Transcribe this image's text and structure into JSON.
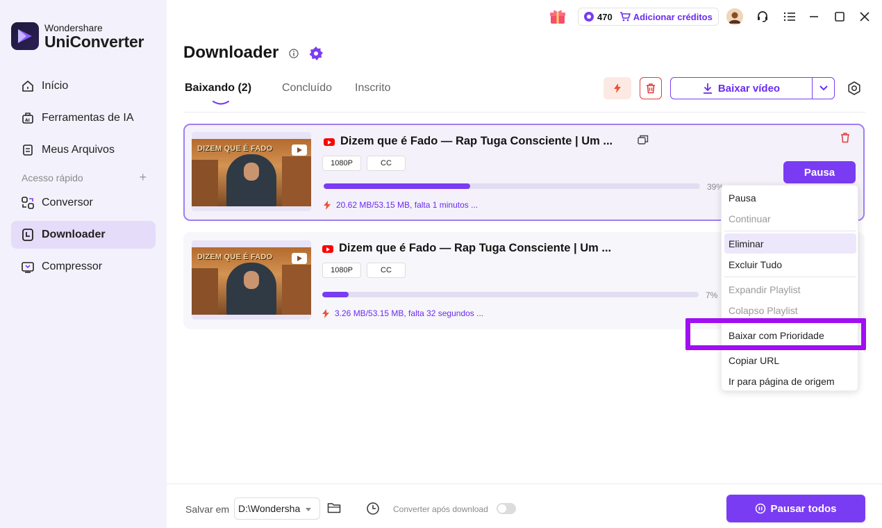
{
  "app": {
    "brand": "Wondershare",
    "product": "UniConverter"
  },
  "sidebar": {
    "items": [
      {
        "label": "Início",
        "icon": "home-icon"
      },
      {
        "label": "Ferramentas de IA",
        "icon": "ai-tools-icon"
      },
      {
        "label": "Meus Arquivos",
        "icon": "files-icon"
      },
      {
        "label": "Conversor",
        "icon": "converter-icon"
      },
      {
        "label": "Downloader",
        "icon": "downloader-icon"
      },
      {
        "label": "Compressor",
        "icon": "compressor-icon"
      }
    ],
    "quick_access": "Acesso rápido",
    "quick_add": "+"
  },
  "topbar": {
    "credits": "470",
    "add_credits": "Adicionar créditos"
  },
  "page": {
    "title": "Downloader"
  },
  "tabs": [
    {
      "label": "Baixando (2)",
      "active": true
    },
    {
      "label": "Concluído",
      "active": false
    },
    {
      "label": "Inscrito",
      "active": false
    }
  ],
  "toolbar": {
    "download_video": "Baixar vídeo"
  },
  "downloads": [
    {
      "thumb_text": "DIZEM QUE É FADO",
      "title": "Dizem que é Fado — Rap Tuga Consciente | Um ...",
      "quality": "1080P",
      "subtitle": "CC",
      "progress": 0.39,
      "percent": "39%",
      "status": "20.62 MB/53.15 MB, falta 1 minutos ...",
      "action": "Pausa"
    },
    {
      "thumb_text": "DIZEM QUE É FADO",
      "title": "Dizem que é Fado — Rap Tuga Consciente | Um ...",
      "quality": "1080P",
      "subtitle": "CC",
      "progress": 0.07,
      "percent": "7%",
      "status": "3.26 MB/53.15 MB, falta 32 segundos ..."
    }
  ],
  "context_menu": {
    "items": [
      {
        "label": "Pausa",
        "enabled": true
      },
      {
        "label": "Continuar",
        "enabled": false
      },
      {
        "label": "Eliminar",
        "enabled": true,
        "hovered": true
      },
      {
        "label": "Excluir Tudo",
        "enabled": true
      },
      {
        "label": "Expandir Playlist",
        "enabled": false
      },
      {
        "label": "Colapso Playlist",
        "enabled": false
      },
      {
        "label": "Baixar com Prioridade",
        "enabled": true,
        "highlighted": true
      },
      {
        "label": "Copiar URL",
        "enabled": true
      },
      {
        "label": "Ir para página de origem",
        "enabled": true
      }
    ]
  },
  "bottom": {
    "save_label": "Salvar em",
    "save_path": "D:\\Wondersha",
    "convert_label": "Converter após download",
    "convert_enabled": false,
    "pause_all": "Pausar todos"
  },
  "colors": {
    "accent": "#7a3cf2",
    "highlight": "#a10ef2",
    "danger": "#e43a3a"
  }
}
